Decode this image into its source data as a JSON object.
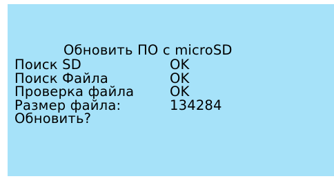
{
  "screen": {
    "background": "#a6e2f9",
    "title": "Обновить ПО с microSD",
    "rows": [
      {
        "label": "Поиск SD",
        "value": "OK"
      },
      {
        "label": "Поиск Файла",
        "value": "OK"
      },
      {
        "label": "Проверка файла",
        "value": "OK"
      },
      {
        "label": "Размер файла:",
        "value": "134284"
      }
    ],
    "prompt": "Обновить?"
  }
}
